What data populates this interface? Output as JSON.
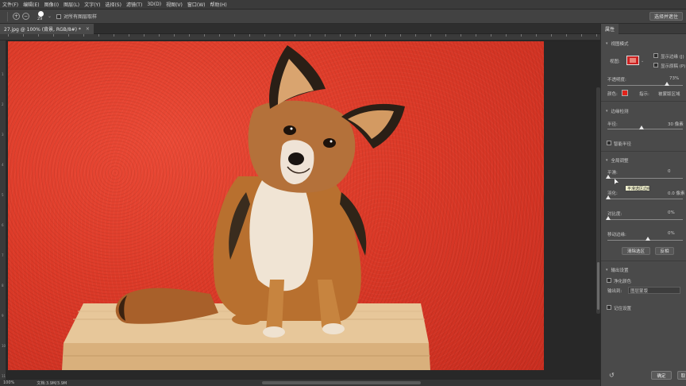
{
  "menu": [
    "文件(F)",
    "编辑(E)",
    "图像(I)",
    "图层(L)",
    "文字(Y)",
    "选择(S)",
    "滤镜(T)",
    "3D(D)",
    "视图(V)",
    "窗口(W)",
    "帮助(H)"
  ],
  "options": {
    "add_icon": "+",
    "subtract_icon": "−",
    "brush_size": "29",
    "sample_all_label": "对所有图层取样",
    "select_and_mask_button": "选择并遮住"
  },
  "document_tab": {
    "title": "27.jpg @ 100% (背景, RGB/8#) *",
    "close": "×"
  },
  "ruler_left_labels": [
    "1",
    "2",
    "3",
    "4",
    "5",
    "6",
    "7",
    "8",
    "9",
    "10",
    "11"
  ],
  "status": {
    "zoom": "100%",
    "doc": "文档:3.9M/3.9M"
  },
  "panel": {
    "tab": "属性",
    "view_mode_section": "视图模式",
    "view_label": "视图:",
    "show_edge": "显示边缘 (J)",
    "show_original": "显示原稿 (P)",
    "opacity_label": "不透明度:",
    "opacity_value": "73%",
    "color_label": "颜色:",
    "indicate_label": "指示:",
    "indicate_value": "被蒙版区域",
    "edge_detection_section": "边缘检测",
    "radius_label": "半径:",
    "radius_value": "30 像素",
    "smart_radius": "智能半径",
    "global_refine_section": "全局调整",
    "smooth_label": "平滑:",
    "smooth_value": "0",
    "feather_label": "羽化:",
    "feather_value": "0.0 像素",
    "contrast_label": "对比度:",
    "contrast_value": "0%",
    "shift_edge_label": "移动边缘:",
    "shift_edge_value": "0%",
    "clear_selection_button": "清除选区",
    "invert_button": "反相",
    "output_section": "输出设置",
    "decontaminate": "净化颜色",
    "output_to_label": "输出到:",
    "output_to_value": "图层蒙版",
    "remember_settings": "记住设置",
    "ok_button": "确定",
    "cancel_button": "取"
  },
  "tooltip": "平滑选区边缘",
  "colors": {
    "mask_color": "#e2231a",
    "photo_background": "#dc3a28"
  },
  "icons": [
    "add-to-selection-icon",
    "subtract-from-selection-icon",
    "brush-preview-icon",
    "chevron-down-icon",
    "cursor-icon",
    "reset-icon"
  ]
}
